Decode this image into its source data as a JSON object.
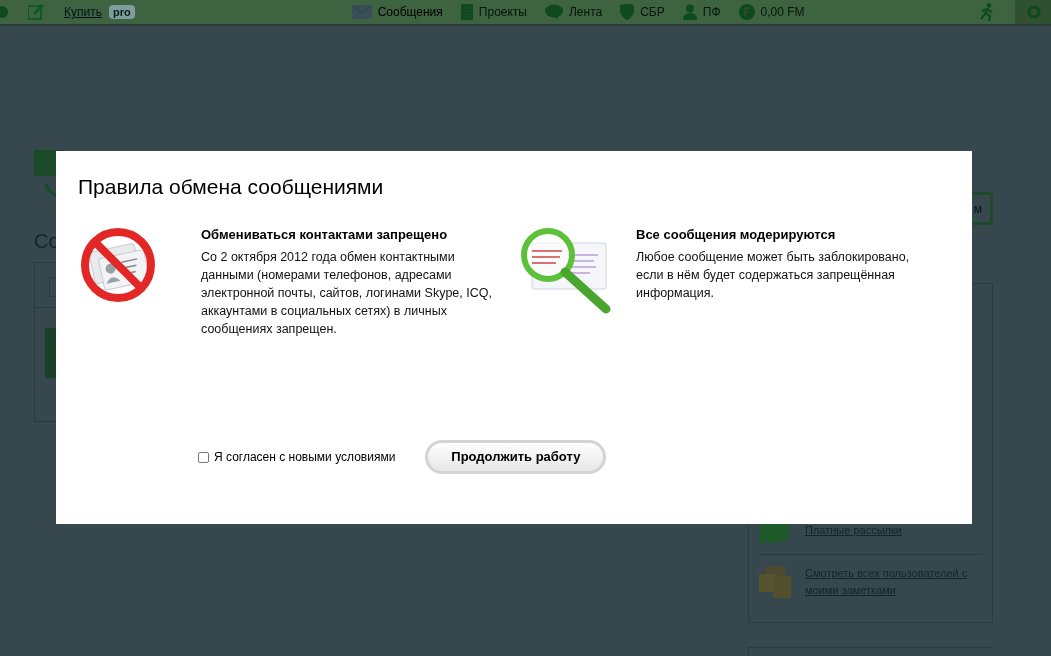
{
  "top_bar": {
    "buy_link": "Купить",
    "pro_badge": "pro",
    "nav": [
      {
        "kind": "mail",
        "label": "Сообщения",
        "selected": true
      },
      {
        "kind": "doc",
        "label": "Проекты",
        "selected": false
      },
      {
        "kind": "bubble",
        "label": "Лента",
        "selected": false
      },
      {
        "kind": "shield",
        "label": "СБР",
        "selected": false
      },
      {
        "kind": "person",
        "label": "ПФ",
        "selected": false
      },
      {
        "kind": "coin",
        "label": "0,00 FM",
        "selected": false
      }
    ]
  },
  "page": {
    "heading": "Со",
    "right_button": "м",
    "side_links": [
      {
        "kind": "folder",
        "label": "Платные рассылки"
      },
      {
        "kind": "notes",
        "label": "Смотреть всех пользователей с моими заметками"
      }
    ]
  },
  "dialog": {
    "title": "Правила обмена сообщениями",
    "rules": [
      {
        "kind": "no-contacts",
        "title": "Обмениваться контактами запрещено",
        "text": "Со 2 октября 2012 года обмен контактными данными (номерами телефонов, адресами электронной почты, сайтов, логинами Skype, ICQ, аккаунтами в социальных сетях) в личных сообщениях запрещен."
      },
      {
        "kind": "moderated",
        "title": "Все сообщения модерируются",
        "text": "Любое сообщение может быть заблокировано, если в нём будет содержаться запрещённая информация."
      }
    ],
    "agree": {
      "label": "Я согласен с новыми условиями",
      "checked": false
    },
    "continue_button": "Продолжить работу"
  }
}
